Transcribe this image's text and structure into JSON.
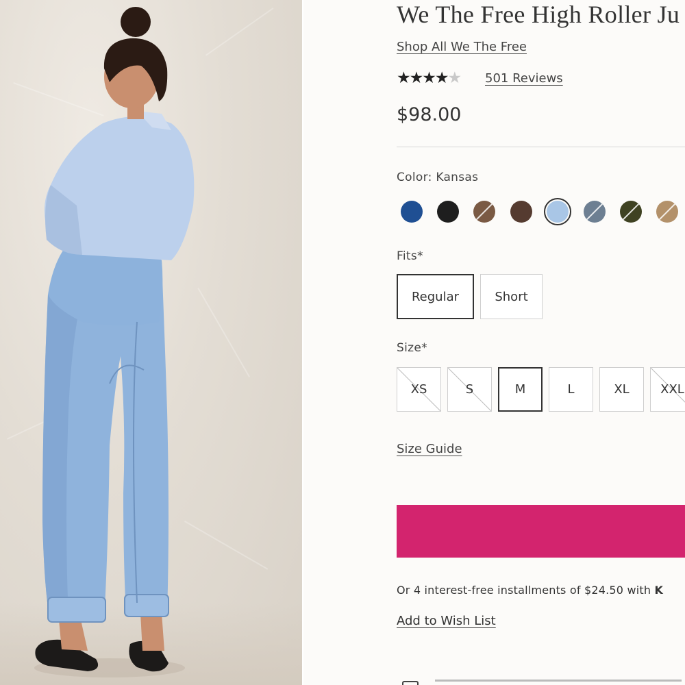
{
  "product": {
    "title": "We The Free High Roller Ju",
    "brand_link": "Shop All We The Free",
    "rating": 4.5,
    "rating_max": 5,
    "reviews_label": "501 Reviews",
    "price": "$98.00"
  },
  "color": {
    "label": "Color: Kansas",
    "swatches": [
      {
        "hex": "#1f4f93",
        "unavailable": false
      },
      {
        "hex": "#1e1e1e",
        "unavailable": false
      },
      {
        "hex": "#7a5a44",
        "unavailable": true
      },
      {
        "hex": "#553b30",
        "unavailable": false
      },
      {
        "hex": "#a9c6e6",
        "unavailable": false,
        "selected": true
      },
      {
        "hex": "#6d7f92",
        "unavailable": true
      },
      {
        "hex": "#3f4222",
        "unavailable": true
      },
      {
        "hex": "#b3916a",
        "unavailable": true
      }
    ]
  },
  "fits": {
    "label": "Fits*",
    "options": [
      {
        "label": "Regular",
        "selected": true
      },
      {
        "label": "Short",
        "selected": false
      }
    ]
  },
  "size": {
    "label": "Size*",
    "options": [
      {
        "label": "XS",
        "unavailable": true,
        "selected": false
      },
      {
        "label": "S",
        "unavailable": true,
        "selected": false
      },
      {
        "label": "M",
        "unavailable": false,
        "selected": true
      },
      {
        "label": "L",
        "unavailable": false,
        "selected": false
      },
      {
        "label": "XL",
        "unavailable": false,
        "selected": false
      },
      {
        "label": "XXL",
        "unavailable": true,
        "selected": false
      }
    ],
    "guide_link": "Size Guide"
  },
  "cart": {
    "button_label": ""
  },
  "installments": {
    "text": "Or 4 interest-free installments of $24.50 with ",
    "provider": "K"
  },
  "wishlist_link": "Add to Wish List",
  "colors": {
    "accent": "#d3246e",
    "text": "#333333",
    "border": "#cfcfcf"
  }
}
